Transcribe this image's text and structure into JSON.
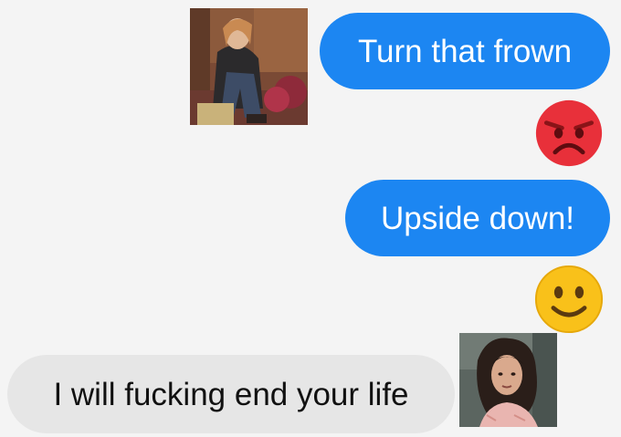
{
  "conversation": {
    "messages": [
      {
        "direction": "outgoing",
        "text": "Turn that frown"
      },
      {
        "direction": "outgoing",
        "reaction": "angry-face"
      },
      {
        "direction": "outgoing",
        "text": "Upside down!"
      },
      {
        "direction": "outgoing",
        "reaction": "smiling-face"
      },
      {
        "direction": "incoming",
        "text": "I will fucking end your life"
      }
    ],
    "photos": [
      {
        "name": "seated-woman-photo",
        "description_icon": "photo"
      },
      {
        "name": "curly-haired-woman-photo",
        "description_icon": "photo"
      }
    ]
  },
  "colors": {
    "background": "#f4f4f4",
    "outgoing_bubble": "#1c86f2",
    "incoming_bubble": "#e6e6e6",
    "angry_face": "#e8303a",
    "smile_face": "#f9c11a"
  }
}
